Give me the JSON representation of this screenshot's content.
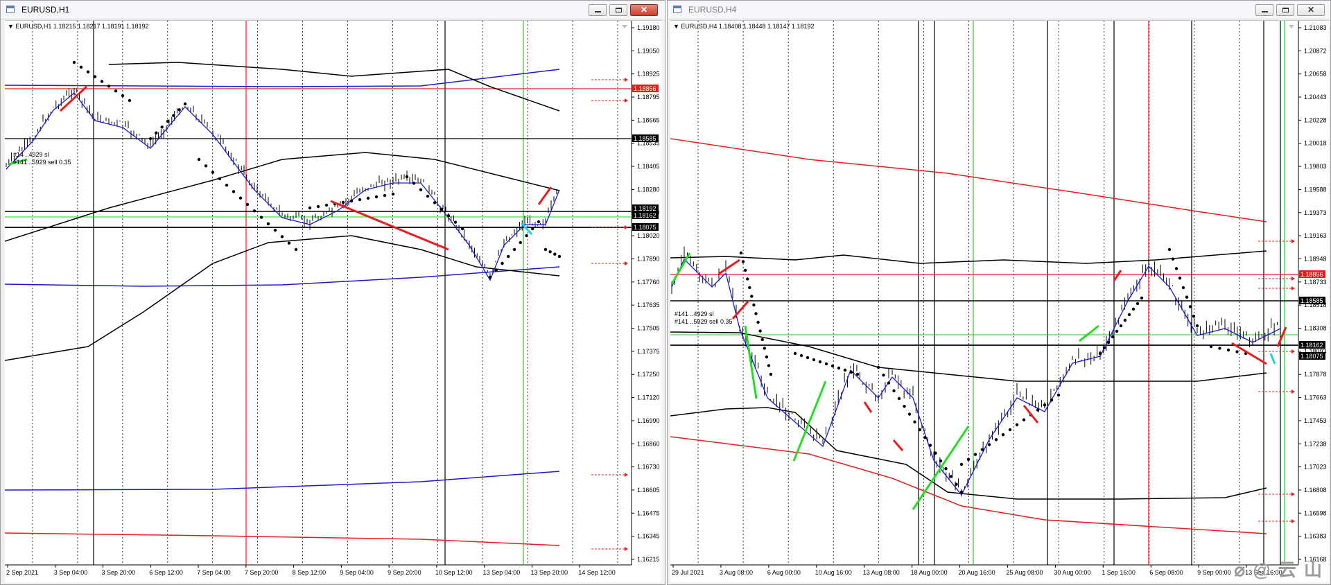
{
  "windows": [
    {
      "id": "h1",
      "title": "EURUSD,H1",
      "info": "EURUSD,H1  1.18215 1.18217 1.18191 1.18192",
      "price_scale": [
        "1.19180",
        "1.19050",
        "1.18925",
        "1.18795",
        "1.18665",
        "1.18535",
        "1.18405",
        "1.18280",
        "1.18150",
        "1.18020",
        "1.17890",
        "1.17760",
        "1.17635",
        "1.17505",
        "1.17375",
        "1.17250",
        "1.17120",
        "1.16990",
        "1.16860",
        "1.16730",
        "1.16605",
        "1.16475",
        "1.16345",
        "1.16215"
      ],
      "price_tags": [
        {
          "label": "1.18856",
          "color": "#e81c1c"
        },
        {
          "label": "1.18585",
          "color": "#000000"
        },
        {
          "label": "1.18192",
          "color": "#000000"
        },
        {
          "label": "1.18162",
          "color": "#000000"
        },
        {
          "label": "1.18075",
          "color": "#000000"
        }
      ],
      "time_labels": [
        "2 Sep 2021",
        "3 Sep 04:00",
        "3 Sep 20:00",
        "6 Sep 12:00",
        "7 Sep 04:00",
        "7 Sep 20:00",
        "8 Sep 12:00",
        "9 Sep 04:00",
        "9 Sep 20:00",
        "10 Sep 12:00",
        "13 Sep 04:00",
        "13 Sep 20:00",
        "14 Sep 12:00"
      ],
      "order_labels": [
        "#14 ..4929 sl",
        "#141 ..5929 sell 0.35"
      ]
    },
    {
      "id": "h4",
      "title": "EURUSD,H4",
      "info": "EURUSD,H4  1.18408 1.18448 1.18147 1.18192",
      "price_scale": [
        "1.21083",
        "1.20872",
        "1.20658",
        "1.20443",
        "1.20228",
        "1.20018",
        "1.19803",
        "1.19588",
        "1.19373",
        "1.19163",
        "1.18948",
        "1.18733",
        "1.18518",
        "1.18308",
        "1.18093",
        "1.17878",
        "1.17663",
        "1.17453",
        "1.17238",
        "1.17023",
        "1.16808",
        "1.16598",
        "1.16383",
        "1.16168"
      ],
      "price_tags": [
        {
          "label": "1.18856",
          "color": "#e81c1c"
        },
        {
          "label": "1.18585",
          "color": "#000000"
        },
        {
          "label": "1.18162",
          "color": "#000000"
        },
        {
          "label": "1.18075",
          "color": "#000000"
        }
      ],
      "time_labels": [
        "29 Jul 2021",
        "3 Aug 08:00",
        "6 Aug 00:00",
        "10 Aug 16:00",
        "13 Aug 08:00",
        "18 Aug 00:00",
        "20 Aug 16:00",
        "25 Aug 08:00",
        "30 Aug 00:00",
        "1 Sep 16:00",
        "6 Sep 08:00",
        "9 Sep 00:00",
        "13 Sep 16:00"
      ],
      "order_labels": [
        "#141 ..4929 sl",
        "#141 ..5929 sell 0.35"
      ]
    }
  ],
  "colors": {
    "bollinger": "#000000",
    "ma": "#1a1adc",
    "channel": "#1a1acc",
    "red_channel": "#e81c1c",
    "bull_segment": "#22dd22",
    "bear_segment": "#e81c1c",
    "vline_red": "#e81c1c",
    "vline_green": "#22cc22"
  }
}
